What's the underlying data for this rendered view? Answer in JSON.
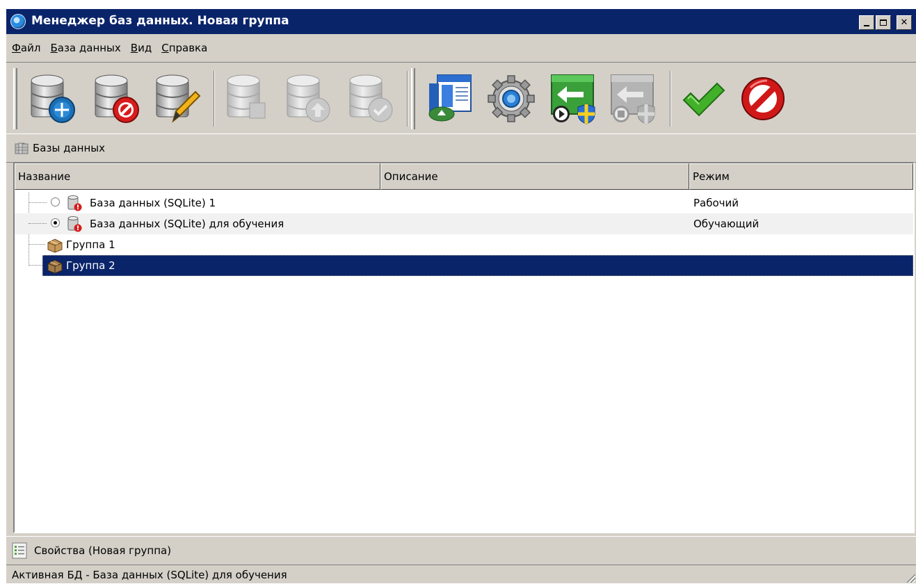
{
  "window": {
    "title": "Менеджер баз данных. Новая группа",
    "title_bar_color": "#0a246a",
    "face_color": "#d4d0c8"
  },
  "menu": {
    "items": [
      {
        "accel": "Ф",
        "rest": "айл"
      },
      {
        "accel": "Б",
        "rest": "аза данных"
      },
      {
        "accel": "В",
        "rest": "ид"
      },
      {
        "accel": "С",
        "rest": "правка"
      }
    ]
  },
  "toolbar": {
    "buttons": [
      {
        "icon": "database-add-icon",
        "enabled": true
      },
      {
        "icon": "database-delete-icon",
        "enabled": true
      },
      {
        "icon": "database-edit-icon",
        "enabled": true
      },
      {
        "icon": "database-disabled-icon",
        "enabled": false
      },
      {
        "icon": "database-upload-icon",
        "enabled": false
      },
      {
        "icon": "database-check-icon",
        "enabled": false
      },
      {
        "icon": "window-run-icon",
        "enabled": true
      },
      {
        "icon": "settings-gear-icon",
        "enabled": true
      },
      {
        "icon": "start-service-icon",
        "enabled": true
      },
      {
        "icon": "stop-service-icon",
        "enabled": false
      },
      {
        "icon": "apply-check-icon",
        "enabled": true
      },
      {
        "icon": "cancel-icon",
        "enabled": true
      }
    ]
  },
  "databases_panel": {
    "label": "Базы данных"
  },
  "table": {
    "columns": [
      "Название",
      "Описание",
      "Режим"
    ],
    "rows": [
      {
        "type": "database",
        "selected_radio": false,
        "name": "База данных (SQLite) 1",
        "description": "",
        "mode": "Рабочий"
      },
      {
        "type": "database",
        "selected_radio": true,
        "name": "База данных (SQLite) для обучения",
        "description": "",
        "mode": "Обучающий"
      },
      {
        "type": "group",
        "name": "Группа 1",
        "description": "",
        "mode": ""
      },
      {
        "type": "group",
        "name": "Группа 2",
        "description": "",
        "mode": "",
        "highlighted": true
      }
    ],
    "selection_color": "#0a246a"
  },
  "properties_panel": {
    "label": "Свойства (Новая группа)"
  },
  "status": {
    "text": "Активная БД - База данных (SQLite) для обучения"
  }
}
